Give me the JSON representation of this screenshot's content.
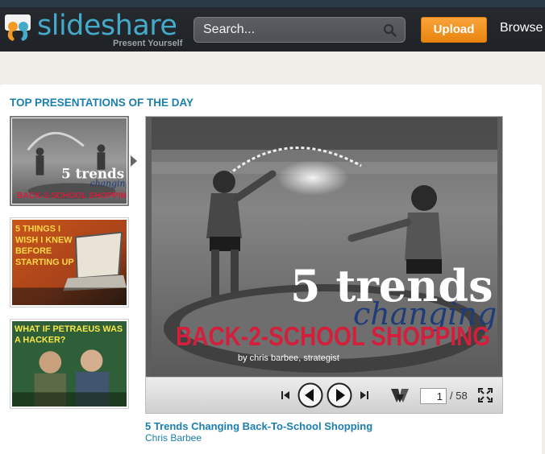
{
  "header": {
    "logo_text": "slideshare",
    "tagline": "Present Yourself",
    "search_placeholder": "Search...",
    "upload_label": "Upload",
    "browse_label": "Browse"
  },
  "section": {
    "title": "TOP PRESENTATIONS OF THE DAY"
  },
  "thumbnails": [
    {
      "line1": "5 trends",
      "line2": "changing",
      "line3": "BACK-2-SCHOOL SHOPPING"
    },
    {
      "text": "5 THINGS I WISH I KNEW BEFORE STARTING UP"
    },
    {
      "text": "WHAT IF PETRAEUS WAS A HACKER?"
    }
  ],
  "slide": {
    "line1": "5 trends",
    "line2": "changing",
    "line3": "BACK-2-SCHOOL SHOPPING",
    "byline": "by chris barbee, strategist"
  },
  "player": {
    "current_page": "1",
    "total_pages": "/ 58"
  },
  "presentation": {
    "title": "5 Trends Changing Back-To-School Shopping",
    "author": "Chris Barbee"
  },
  "colors": {
    "link": "#1a7fb0",
    "upload": "#f39a26",
    "logo": "#45a9c9",
    "accent_red": "#d21f3c"
  }
}
